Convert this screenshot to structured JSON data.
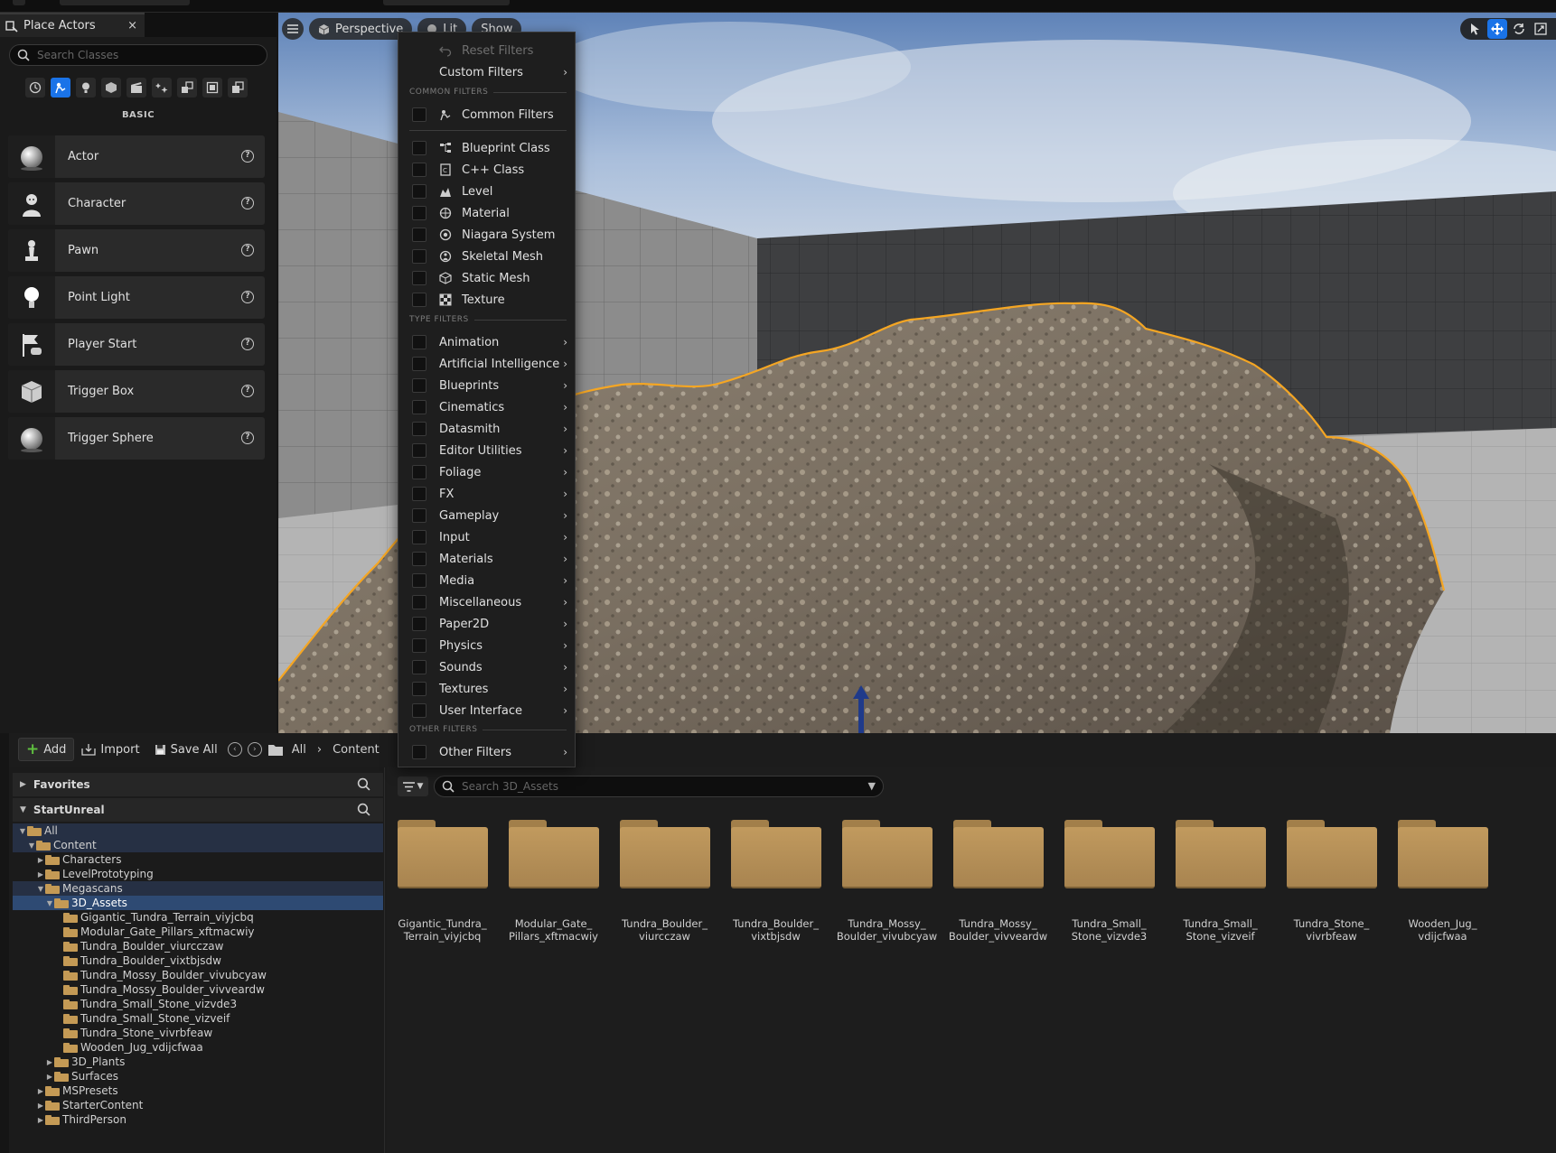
{
  "place_actors": {
    "tab_title": "Place Actors",
    "close_glyph": "×",
    "search_placeholder": "Search Classes",
    "categories": [
      "recent-icon",
      "basic-icon",
      "lights-icon",
      "shapes-icon",
      "cinematic-icon",
      "visual-effects-icon",
      "geometry-icon",
      "volumes-icon",
      "all-classes-icon"
    ],
    "active_category": 1,
    "heading": "BASIC",
    "actors": [
      {
        "label": "Actor",
        "icon": "sphere-icon"
      },
      {
        "label": "Character",
        "icon": "character-icon"
      },
      {
        "label": "Pawn",
        "icon": "pawn-icon"
      },
      {
        "label": "Point Light",
        "icon": "bulb-icon"
      },
      {
        "label": "Player Start",
        "icon": "flag-icon"
      },
      {
        "label": "Trigger Box",
        "icon": "cube-icon"
      },
      {
        "label": "Trigger Sphere",
        "icon": "sphere-icon"
      }
    ],
    "help_glyph": "?"
  },
  "viewport": {
    "perspective_label": "Perspective",
    "lit_label": "Lit",
    "show_label": "Show",
    "selection_color": "#f5a623",
    "accent": "#1a73e8"
  },
  "filter_menu": {
    "reset": "Reset Filters",
    "custom": "Custom Filters",
    "common_heading": "COMMON FILTERS",
    "common_item": "Common Filters",
    "asset_types": [
      {
        "label": "Blueprint Class",
        "icon": "blueprint-icon"
      },
      {
        "label": "C++ Class",
        "icon": "cpp-icon"
      },
      {
        "label": "Level",
        "icon": "level-icon"
      },
      {
        "label": "Material",
        "icon": "material-icon"
      },
      {
        "label": "Niagara System",
        "icon": "niagara-icon"
      },
      {
        "label": "Skeletal Mesh",
        "icon": "skeletal-mesh-icon"
      },
      {
        "label": "Static Mesh",
        "icon": "static-mesh-icon"
      },
      {
        "label": "Texture",
        "icon": "texture-icon"
      }
    ],
    "type_heading": "TYPE FILTERS",
    "type_filters": [
      "Animation",
      "Artificial Intelligence",
      "Blueprints",
      "Cinematics",
      "Datasmith",
      "Editor Utilities",
      "Foliage",
      "FX",
      "Gameplay",
      "Input",
      "Materials",
      "Media",
      "Miscellaneous",
      "Paper2D",
      "Physics",
      "Sounds",
      "Textures",
      "User Interface"
    ],
    "other_heading": "OTHER FILTERS",
    "other_item": "Other Filters",
    "arrow": "›"
  },
  "content_browser": {
    "add": "Add",
    "import": "Import",
    "save_all": "Save All",
    "crumbs": [
      "All",
      "Content"
    ],
    "crumb_sep": "›",
    "favorites": "Favorites",
    "project": "StartUnreal",
    "tree": [
      {
        "label": "All",
        "depth": 0,
        "exp": "▼",
        "state": "sel-parent"
      },
      {
        "label": "Content",
        "depth": 1,
        "exp": "▼",
        "state": "sel-parent"
      },
      {
        "label": "Characters",
        "depth": 2,
        "exp": "▶",
        "state": ""
      },
      {
        "label": "LevelPrototyping",
        "depth": 2,
        "exp": "▶",
        "state": ""
      },
      {
        "label": "Megascans",
        "depth": 2,
        "exp": "▼",
        "state": "sel-parent"
      },
      {
        "label": "3D_Assets",
        "depth": 3,
        "exp": "▼",
        "state": "sel"
      },
      {
        "label": "Gigantic_Tundra_Terrain_viyjcbq",
        "depth": 4,
        "exp": "",
        "state": ""
      },
      {
        "label": "Modular_Gate_Pillars_xftmacwiy",
        "depth": 4,
        "exp": "",
        "state": ""
      },
      {
        "label": "Tundra_Boulder_viurcczaw",
        "depth": 4,
        "exp": "",
        "state": ""
      },
      {
        "label": "Tundra_Boulder_vixtbjsdw",
        "depth": 4,
        "exp": "",
        "state": ""
      },
      {
        "label": "Tundra_Mossy_Boulder_vivubcyaw",
        "depth": 4,
        "exp": "",
        "state": ""
      },
      {
        "label": "Tundra_Mossy_Boulder_vivveardw",
        "depth": 4,
        "exp": "",
        "state": ""
      },
      {
        "label": "Tundra_Small_Stone_vizvde3",
        "depth": 4,
        "exp": "",
        "state": ""
      },
      {
        "label": "Tundra_Small_Stone_vizveif",
        "depth": 4,
        "exp": "",
        "state": ""
      },
      {
        "label": "Tundra_Stone_vivrbfeaw",
        "depth": 4,
        "exp": "",
        "state": ""
      },
      {
        "label": "Wooden_Jug_vdijcfwaa",
        "depth": 4,
        "exp": "",
        "state": ""
      },
      {
        "label": "3D_Plants",
        "depth": 3,
        "exp": "▶",
        "state": ""
      },
      {
        "label": "Surfaces",
        "depth": 3,
        "exp": "▶",
        "state": ""
      },
      {
        "label": "MSPresets",
        "depth": 2,
        "exp": "▶",
        "state": ""
      },
      {
        "label": "StarterContent",
        "depth": 2,
        "exp": "▶",
        "state": ""
      },
      {
        "label": "ThirdPerson",
        "depth": 2,
        "exp": "▶",
        "state": ""
      }
    ],
    "asset_search_placeholder": "Search 3D_Assets",
    "assets": [
      [
        "Gigantic_Tundra_",
        "Terrain_viyjcbq"
      ],
      [
        "Modular_Gate_",
        "Pillars_xftmacwiy"
      ],
      [
        "Tundra_Boulder_",
        "viurcczaw"
      ],
      [
        "Tundra_Boulder_",
        "vixtbjsdw"
      ],
      [
        "Tundra_Mossy_",
        "Boulder_vivubcyaw"
      ],
      [
        "Tundra_Mossy_",
        "Boulder_vivveardw"
      ],
      [
        "Tundra_Small_",
        "Stone_vizvde3"
      ],
      [
        "Tundra_Small_",
        "Stone_vizveif"
      ],
      [
        "Tundra_Stone_",
        "vivrbfeaw"
      ],
      [
        "Wooden_Jug_",
        "vdijcfwaa"
      ]
    ]
  }
}
